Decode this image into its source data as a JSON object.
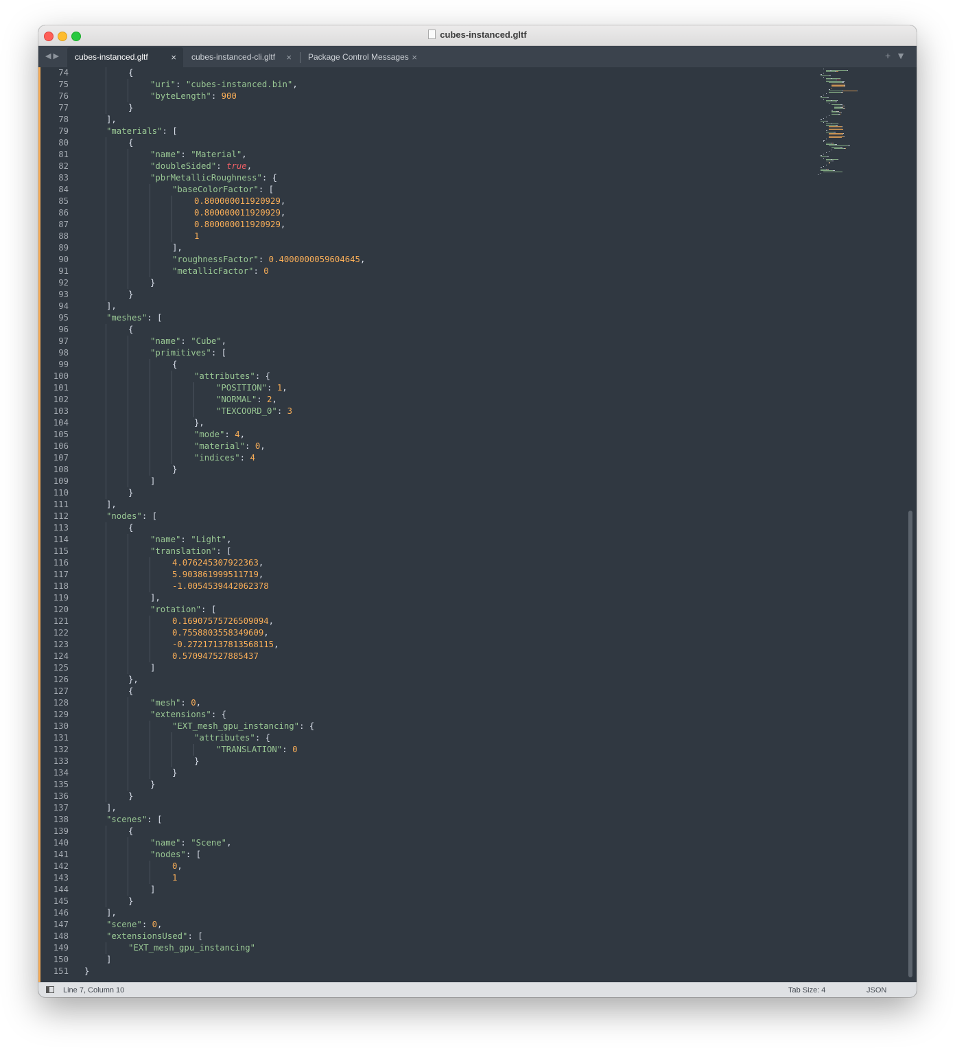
{
  "window": {
    "title": "cubes-instanced.gltf"
  },
  "tabs": [
    {
      "label": "cubes-instanced.gltf",
      "active": true
    },
    {
      "label": "cubes-instanced-cli.gltf",
      "active": false
    },
    {
      "label": "Package Control Messages",
      "active": false
    }
  ],
  "tab_controls": {
    "close_glyph": "×",
    "back_glyph": "◀",
    "forward_glyph": "▶",
    "new_tab_glyph": "+",
    "menu_glyph": "▼"
  },
  "status_bar": {
    "position": "Line 7, Column 10",
    "tab_size": "Tab Size: 4",
    "syntax": "JSON"
  },
  "colors": {
    "background": "#303841",
    "string": "#99c794",
    "number": "#f9ae58",
    "boolean": "#ec5f66",
    "punctuation": "#d8dee9",
    "gutter": "#a5abb2"
  },
  "editor": {
    "lines": [
      {
        "n": "74",
        "i": 2,
        "t": [
          [
            "p",
            "{"
          ]
        ]
      },
      {
        "n": "75",
        "i": 3,
        "t": [
          [
            "s",
            "\"uri\""
          ],
          [
            "p",
            ": "
          ],
          [
            "s",
            "\"cubes-instanced.bin\""
          ],
          [
            "p",
            ","
          ]
        ]
      },
      {
        "n": "76",
        "i": 3,
        "t": [
          [
            "s",
            "\"byteLength\""
          ],
          [
            "p",
            ": "
          ],
          [
            "n",
            "900"
          ]
        ]
      },
      {
        "n": "77",
        "i": 2,
        "t": [
          [
            "p",
            "}"
          ]
        ]
      },
      {
        "n": "78",
        "i": 1,
        "t": [
          [
            "p",
            "],"
          ]
        ]
      },
      {
        "n": "79",
        "i": 1,
        "t": [
          [
            "s",
            "\"materials\""
          ],
          [
            "p",
            ": ["
          ]
        ]
      },
      {
        "n": "80",
        "i": 2,
        "t": [
          [
            "p",
            "{"
          ]
        ]
      },
      {
        "n": "81",
        "i": 3,
        "t": [
          [
            "s",
            "\"name\""
          ],
          [
            "p",
            ": "
          ],
          [
            "s",
            "\"Material\""
          ],
          [
            "p",
            ","
          ]
        ]
      },
      {
        "n": "82",
        "i": 3,
        "t": [
          [
            "s",
            "\"doubleSided\""
          ],
          [
            "p",
            ": "
          ],
          [
            "b",
            "true"
          ],
          [
            "p",
            ","
          ]
        ]
      },
      {
        "n": "83",
        "i": 3,
        "t": [
          [
            "s",
            "\"pbrMetallicRoughness\""
          ],
          [
            "p",
            ": {"
          ]
        ]
      },
      {
        "n": "84",
        "i": 4,
        "t": [
          [
            "s",
            "\"baseColorFactor\""
          ],
          [
            "p",
            ": ["
          ]
        ]
      },
      {
        "n": "85",
        "i": 5,
        "t": [
          [
            "n",
            "0.800000011920929"
          ],
          [
            "p",
            ","
          ]
        ]
      },
      {
        "n": "86",
        "i": 5,
        "t": [
          [
            "n",
            "0.800000011920929"
          ],
          [
            "p",
            ","
          ]
        ]
      },
      {
        "n": "87",
        "i": 5,
        "t": [
          [
            "n",
            "0.800000011920929"
          ],
          [
            "p",
            ","
          ]
        ]
      },
      {
        "n": "88",
        "i": 5,
        "t": [
          [
            "n",
            "1"
          ]
        ]
      },
      {
        "n": "89",
        "i": 4,
        "t": [
          [
            "p",
            "],"
          ]
        ]
      },
      {
        "n": "90",
        "i": 4,
        "t": [
          [
            "s",
            "\"roughnessFactor\""
          ],
          [
            "p",
            ": "
          ],
          [
            "n",
            "0.4000000059604645"
          ],
          [
            "p",
            ","
          ]
        ]
      },
      {
        "n": "91",
        "i": 4,
        "t": [
          [
            "s",
            "\"metallicFactor\""
          ],
          [
            "p",
            ": "
          ],
          [
            "n",
            "0"
          ]
        ]
      },
      {
        "n": "92",
        "i": 3,
        "t": [
          [
            "p",
            "}"
          ]
        ]
      },
      {
        "n": "93",
        "i": 2,
        "t": [
          [
            "p",
            "}"
          ]
        ]
      },
      {
        "n": "94",
        "i": 1,
        "t": [
          [
            "p",
            "],"
          ]
        ]
      },
      {
        "n": "95",
        "i": 1,
        "t": [
          [
            "s",
            "\"meshes\""
          ],
          [
            "p",
            ": ["
          ]
        ]
      },
      {
        "n": "96",
        "i": 2,
        "t": [
          [
            "p",
            "{"
          ]
        ]
      },
      {
        "n": "97",
        "i": 3,
        "t": [
          [
            "s",
            "\"name\""
          ],
          [
            "p",
            ": "
          ],
          [
            "s",
            "\"Cube\""
          ],
          [
            "p",
            ","
          ]
        ]
      },
      {
        "n": "98",
        "i": 3,
        "t": [
          [
            "s",
            "\"primitives\""
          ],
          [
            "p",
            ": ["
          ]
        ]
      },
      {
        "n": "99",
        "i": 4,
        "t": [
          [
            "p",
            "{"
          ]
        ]
      },
      {
        "n": "100",
        "i": 5,
        "t": [
          [
            "s",
            "\"attributes\""
          ],
          [
            "p",
            ": {"
          ]
        ]
      },
      {
        "n": "101",
        "i": 6,
        "t": [
          [
            "s",
            "\"POSITION\""
          ],
          [
            "p",
            ": "
          ],
          [
            "n",
            "1"
          ],
          [
            "p",
            ","
          ]
        ]
      },
      {
        "n": "102",
        "i": 6,
        "t": [
          [
            "s",
            "\"NORMAL\""
          ],
          [
            "p",
            ": "
          ],
          [
            "n",
            "2"
          ],
          [
            "p",
            ","
          ]
        ]
      },
      {
        "n": "103",
        "i": 6,
        "t": [
          [
            "s",
            "\"TEXCOORD_0\""
          ],
          [
            "p",
            ": "
          ],
          [
            "n",
            "3"
          ]
        ]
      },
      {
        "n": "104",
        "i": 5,
        "t": [
          [
            "p",
            "},"
          ]
        ]
      },
      {
        "n": "105",
        "i": 5,
        "t": [
          [
            "s",
            "\"mode\""
          ],
          [
            "p",
            ": "
          ],
          [
            "n",
            "4"
          ],
          [
            "p",
            ","
          ]
        ]
      },
      {
        "n": "106",
        "i": 5,
        "t": [
          [
            "s",
            "\"material\""
          ],
          [
            "p",
            ": "
          ],
          [
            "n",
            "0"
          ],
          [
            "p",
            ","
          ]
        ]
      },
      {
        "n": "107",
        "i": 5,
        "t": [
          [
            "s",
            "\"indices\""
          ],
          [
            "p",
            ": "
          ],
          [
            "n",
            "4"
          ]
        ]
      },
      {
        "n": "108",
        "i": 4,
        "t": [
          [
            "p",
            "}"
          ]
        ]
      },
      {
        "n": "109",
        "i": 3,
        "t": [
          [
            "p",
            "]"
          ]
        ]
      },
      {
        "n": "110",
        "i": 2,
        "t": [
          [
            "p",
            "}"
          ]
        ]
      },
      {
        "n": "111",
        "i": 1,
        "t": [
          [
            "p",
            "],"
          ]
        ]
      },
      {
        "n": "112",
        "i": 1,
        "t": [
          [
            "s",
            "\"nodes\""
          ],
          [
            "p",
            ": ["
          ]
        ]
      },
      {
        "n": "113",
        "i": 2,
        "t": [
          [
            "p",
            "{"
          ]
        ]
      },
      {
        "n": "114",
        "i": 3,
        "t": [
          [
            "s",
            "\"name\""
          ],
          [
            "p",
            ": "
          ],
          [
            "s",
            "\"Light\""
          ],
          [
            "p",
            ","
          ]
        ]
      },
      {
        "n": "115",
        "i": 3,
        "t": [
          [
            "s",
            "\"translation\""
          ],
          [
            "p",
            ": ["
          ]
        ]
      },
      {
        "n": "116",
        "i": 4,
        "t": [
          [
            "n",
            "4.076245307922363"
          ],
          [
            "p",
            ","
          ]
        ]
      },
      {
        "n": "117",
        "i": 4,
        "t": [
          [
            "n",
            "5.903861999511719"
          ],
          [
            "p",
            ","
          ]
        ]
      },
      {
        "n": "118",
        "i": 4,
        "t": [
          [
            "n",
            "-1.0054539442062378"
          ]
        ]
      },
      {
        "n": "119",
        "i": 3,
        "t": [
          [
            "p",
            "],"
          ]
        ]
      },
      {
        "n": "120",
        "i": 3,
        "t": [
          [
            "s",
            "\"rotation\""
          ],
          [
            "p",
            ": ["
          ]
        ]
      },
      {
        "n": "121",
        "i": 4,
        "t": [
          [
            "n",
            "0.16907575726509094"
          ],
          [
            "p",
            ","
          ]
        ]
      },
      {
        "n": "122",
        "i": 4,
        "t": [
          [
            "n",
            "0.7558803558349609"
          ],
          [
            "p",
            ","
          ]
        ]
      },
      {
        "n": "123",
        "i": 4,
        "t": [
          [
            "n",
            "-0.27217137813568115"
          ],
          [
            "p",
            ","
          ]
        ]
      },
      {
        "n": "124",
        "i": 4,
        "t": [
          [
            "n",
            "0.570947527885437"
          ]
        ]
      },
      {
        "n": "125",
        "i": 3,
        "t": [
          [
            "p",
            "]"
          ]
        ]
      },
      {
        "n": "126",
        "i": 2,
        "t": [
          [
            "p",
            "},"
          ]
        ]
      },
      {
        "n": "127",
        "i": 2,
        "t": [
          [
            "p",
            "{"
          ]
        ]
      },
      {
        "n": "128",
        "i": 3,
        "t": [
          [
            "s",
            "\"mesh\""
          ],
          [
            "p",
            ": "
          ],
          [
            "n",
            "0"
          ],
          [
            "p",
            ","
          ]
        ]
      },
      {
        "n": "129",
        "i": 3,
        "t": [
          [
            "s",
            "\"extensions\""
          ],
          [
            "p",
            ": {"
          ]
        ]
      },
      {
        "n": "130",
        "i": 4,
        "t": [
          [
            "s",
            "\"EXT_mesh_gpu_instancing\""
          ],
          [
            "p",
            ": {"
          ]
        ]
      },
      {
        "n": "131",
        "i": 5,
        "t": [
          [
            "s",
            "\"attributes\""
          ],
          [
            "p",
            ": {"
          ]
        ]
      },
      {
        "n": "132",
        "i": 6,
        "t": [
          [
            "s",
            "\"TRANSLATION\""
          ],
          [
            "p",
            ": "
          ],
          [
            "n",
            "0"
          ]
        ]
      },
      {
        "n": "133",
        "i": 5,
        "t": [
          [
            "p",
            "}"
          ]
        ]
      },
      {
        "n": "134",
        "i": 4,
        "t": [
          [
            "p",
            "}"
          ]
        ]
      },
      {
        "n": "135",
        "i": 3,
        "t": [
          [
            "p",
            "}"
          ]
        ]
      },
      {
        "n": "136",
        "i": 2,
        "t": [
          [
            "p",
            "}"
          ]
        ]
      },
      {
        "n": "137",
        "i": 1,
        "t": [
          [
            "p",
            "],"
          ]
        ]
      },
      {
        "n": "138",
        "i": 1,
        "t": [
          [
            "s",
            "\"scenes\""
          ],
          [
            "p",
            ": ["
          ]
        ]
      },
      {
        "n": "139",
        "i": 2,
        "t": [
          [
            "p",
            "{"
          ]
        ]
      },
      {
        "n": "140",
        "i": 3,
        "t": [
          [
            "s",
            "\"name\""
          ],
          [
            "p",
            ": "
          ],
          [
            "s",
            "\"Scene\""
          ],
          [
            "p",
            ","
          ]
        ]
      },
      {
        "n": "141",
        "i": 3,
        "t": [
          [
            "s",
            "\"nodes\""
          ],
          [
            "p",
            ": ["
          ]
        ]
      },
      {
        "n": "142",
        "i": 4,
        "t": [
          [
            "n",
            "0"
          ],
          [
            "p",
            ","
          ]
        ]
      },
      {
        "n": "143",
        "i": 4,
        "t": [
          [
            "n",
            "1"
          ]
        ]
      },
      {
        "n": "144",
        "i": 3,
        "t": [
          [
            "p",
            "]"
          ]
        ]
      },
      {
        "n": "145",
        "i": 2,
        "t": [
          [
            "p",
            "}"
          ]
        ]
      },
      {
        "n": "146",
        "i": 1,
        "t": [
          [
            "p",
            "],"
          ]
        ]
      },
      {
        "n": "147",
        "i": 1,
        "t": [
          [
            "s",
            "\"scene\""
          ],
          [
            "p",
            ": "
          ],
          [
            "n",
            "0"
          ],
          [
            "p",
            ","
          ]
        ]
      },
      {
        "n": "148",
        "i": 1,
        "t": [
          [
            "s",
            "\"extensionsUsed\""
          ],
          [
            "p",
            ": ["
          ]
        ]
      },
      {
        "n": "149",
        "i": 2,
        "t": [
          [
            "s",
            "\"EXT_mesh_gpu_instancing\""
          ]
        ]
      },
      {
        "n": "150",
        "i": 1,
        "t": [
          [
            "p",
            "]"
          ]
        ]
      },
      {
        "n": "151",
        "i": 0,
        "t": [
          [
            "p",
            "}"
          ]
        ]
      }
    ]
  }
}
